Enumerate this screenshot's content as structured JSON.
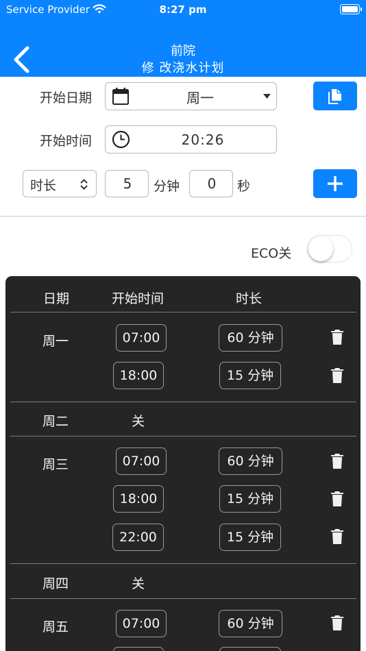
{
  "status_bar": {
    "carrier": "Service Provider",
    "time": "8:27 pm"
  },
  "nav": {
    "title": "前院",
    "subtitle": "修 改浇水计划"
  },
  "form": {
    "start_date_label": "开始日期",
    "start_date_value": "周一",
    "start_time_label": "开始时间",
    "start_time_value": "20:26",
    "duration_select": "时长",
    "minutes_value": "5",
    "minutes_unit": "分钟",
    "seconds_value": "0",
    "seconds_unit": "秒"
  },
  "eco": {
    "label": "ECO关",
    "enabled": false
  },
  "schedule": {
    "headers": {
      "day": "日期",
      "start": "开始时间",
      "duration": "时长"
    },
    "days": [
      {
        "day": "周一",
        "entries": [
          {
            "time": "07:00",
            "duration": "60 分钟"
          },
          {
            "time": "18:00",
            "duration": "15 分钟"
          }
        ]
      },
      {
        "day": "周二",
        "off": "关"
      },
      {
        "day": "周三",
        "entries": [
          {
            "time": "07:00",
            "duration": "60 分钟"
          },
          {
            "time": "18:00",
            "duration": "15 分钟"
          },
          {
            "time": "22:00",
            "duration": "15 分钟"
          }
        ]
      },
      {
        "day": "周四",
        "off": "关"
      },
      {
        "day": "周五",
        "entries": [
          {
            "time": "07:00",
            "duration": "60 分钟"
          }
        ]
      }
    ]
  },
  "colors": {
    "accent": "#0a84ff",
    "panel": "#252525"
  }
}
